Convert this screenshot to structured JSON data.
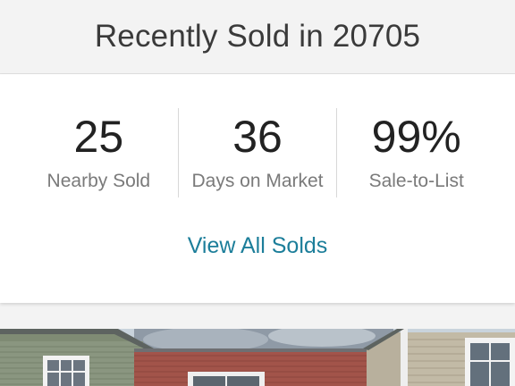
{
  "header": {
    "title": "Recently Sold in 20705"
  },
  "stats": [
    {
      "value": "25",
      "label": "Nearby Sold"
    },
    {
      "value": "36",
      "label": "Days on Market"
    },
    {
      "value": "99%",
      "label": "Sale-to-List"
    }
  ],
  "view_all_label": "View All Solds"
}
